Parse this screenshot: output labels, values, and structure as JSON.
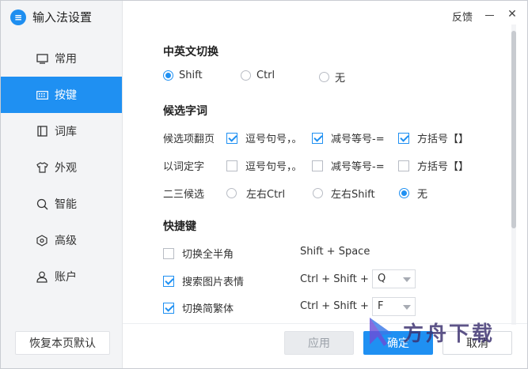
{
  "app": {
    "title": "输入法设置",
    "logo_letter": "≡"
  },
  "titlebar": {
    "feedback": "反馈",
    "minimize_icon": "minimize-icon",
    "close_icon": "close-icon",
    "close_glyph": "✕"
  },
  "sidebar": {
    "items": [
      {
        "label": "常用",
        "icon": "monitor-icon",
        "glyph": "▭",
        "active": false
      },
      {
        "label": "按键",
        "icon": "keyboard-icon",
        "glyph": "⌨",
        "active": true
      },
      {
        "label": "词库",
        "icon": "book-icon",
        "glyph": "▯",
        "active": false
      },
      {
        "label": "外观",
        "icon": "shirt-icon",
        "glyph": "♡",
        "active": false
      },
      {
        "label": "智能",
        "icon": "search-icon",
        "glyph": "○",
        "active": false
      },
      {
        "label": "高级",
        "icon": "hexagon-icon",
        "glyph": "⬡",
        "active": false
      },
      {
        "label": "账户",
        "icon": "user-icon",
        "glyph": "♙",
        "active": false
      }
    ],
    "restore_default": "恢复本页默认"
  },
  "switch_section": {
    "title": "中英文切换",
    "options": [
      {
        "label": "Shift",
        "selected": true
      },
      {
        "label": "Ctrl",
        "selected": false
      },
      {
        "label": "无",
        "selected": false
      }
    ]
  },
  "candidate_section": {
    "title": "候选字词",
    "page_turn": {
      "label": "候选项翻页",
      "options": [
        {
          "label": "逗号句号，。",
          "checked": true
        },
        {
          "label": "减号等号-=",
          "checked": true
        },
        {
          "label": "方括号【】",
          "checked": true
        }
      ]
    },
    "select_char": {
      "label": "以词定字",
      "options": [
        {
          "label": "逗号句号，。",
          "checked": false
        },
        {
          "label": "减号等号-=",
          "checked": false
        },
        {
          "label": "方括号【】",
          "checked": false
        }
      ]
    },
    "second_third": {
      "label": "二三候选",
      "options": [
        {
          "label": "左右Ctrl",
          "selected": false
        },
        {
          "label": "左右Shift",
          "selected": false
        },
        {
          "label": "无",
          "selected": true
        }
      ]
    }
  },
  "hotkey_section": {
    "title": "快捷键",
    "items": [
      {
        "label": "切换全半角",
        "checked": false,
        "keys": "Shift + Space",
        "key_value": ""
      },
      {
        "label": "搜索图片表情",
        "checked": true,
        "keys": "Ctrl + Shift +",
        "key_value": "Q"
      },
      {
        "label": "切换简繁体",
        "checked": true,
        "keys": "Ctrl + Shift +",
        "key_value": "F"
      }
    ]
  },
  "footer": {
    "apply": "应用",
    "ok": "确定",
    "cancel": "取消"
  },
  "watermark": {
    "text": "方舟下载"
  },
  "colors": {
    "accent": "#1f90f2",
    "sidebar_bg": "#f3f4f6"
  }
}
